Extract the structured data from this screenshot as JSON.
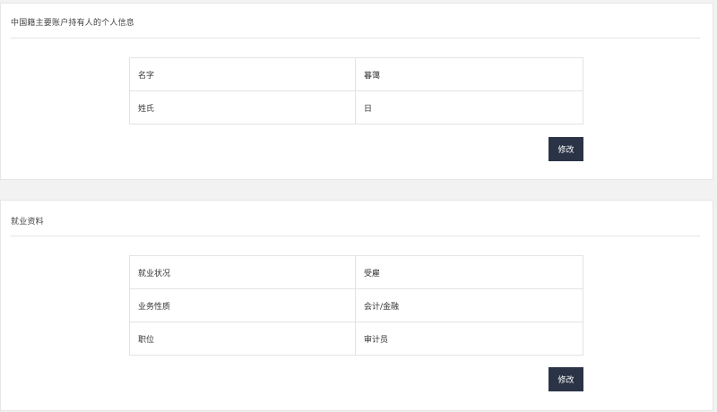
{
  "personal_info": {
    "title": "中国籍主要账户持有人的个人信息",
    "rows": [
      {
        "label": "名字",
        "value": "暮蔼"
      },
      {
        "label": "姓氏",
        "value": "日"
      }
    ],
    "edit_label": "修改"
  },
  "employment_info": {
    "title": "就业资料",
    "rows": [
      {
        "label": "就业状况",
        "value": "受雇"
      },
      {
        "label": "业务性质",
        "value": "会计/金融"
      },
      {
        "label": "职位",
        "value": "审计员"
      }
    ],
    "edit_label": "修改"
  },
  "colors": {
    "button_bg": "#2b3446",
    "page_bg": "#f2f2f2",
    "border": "#e3e3e3"
  }
}
